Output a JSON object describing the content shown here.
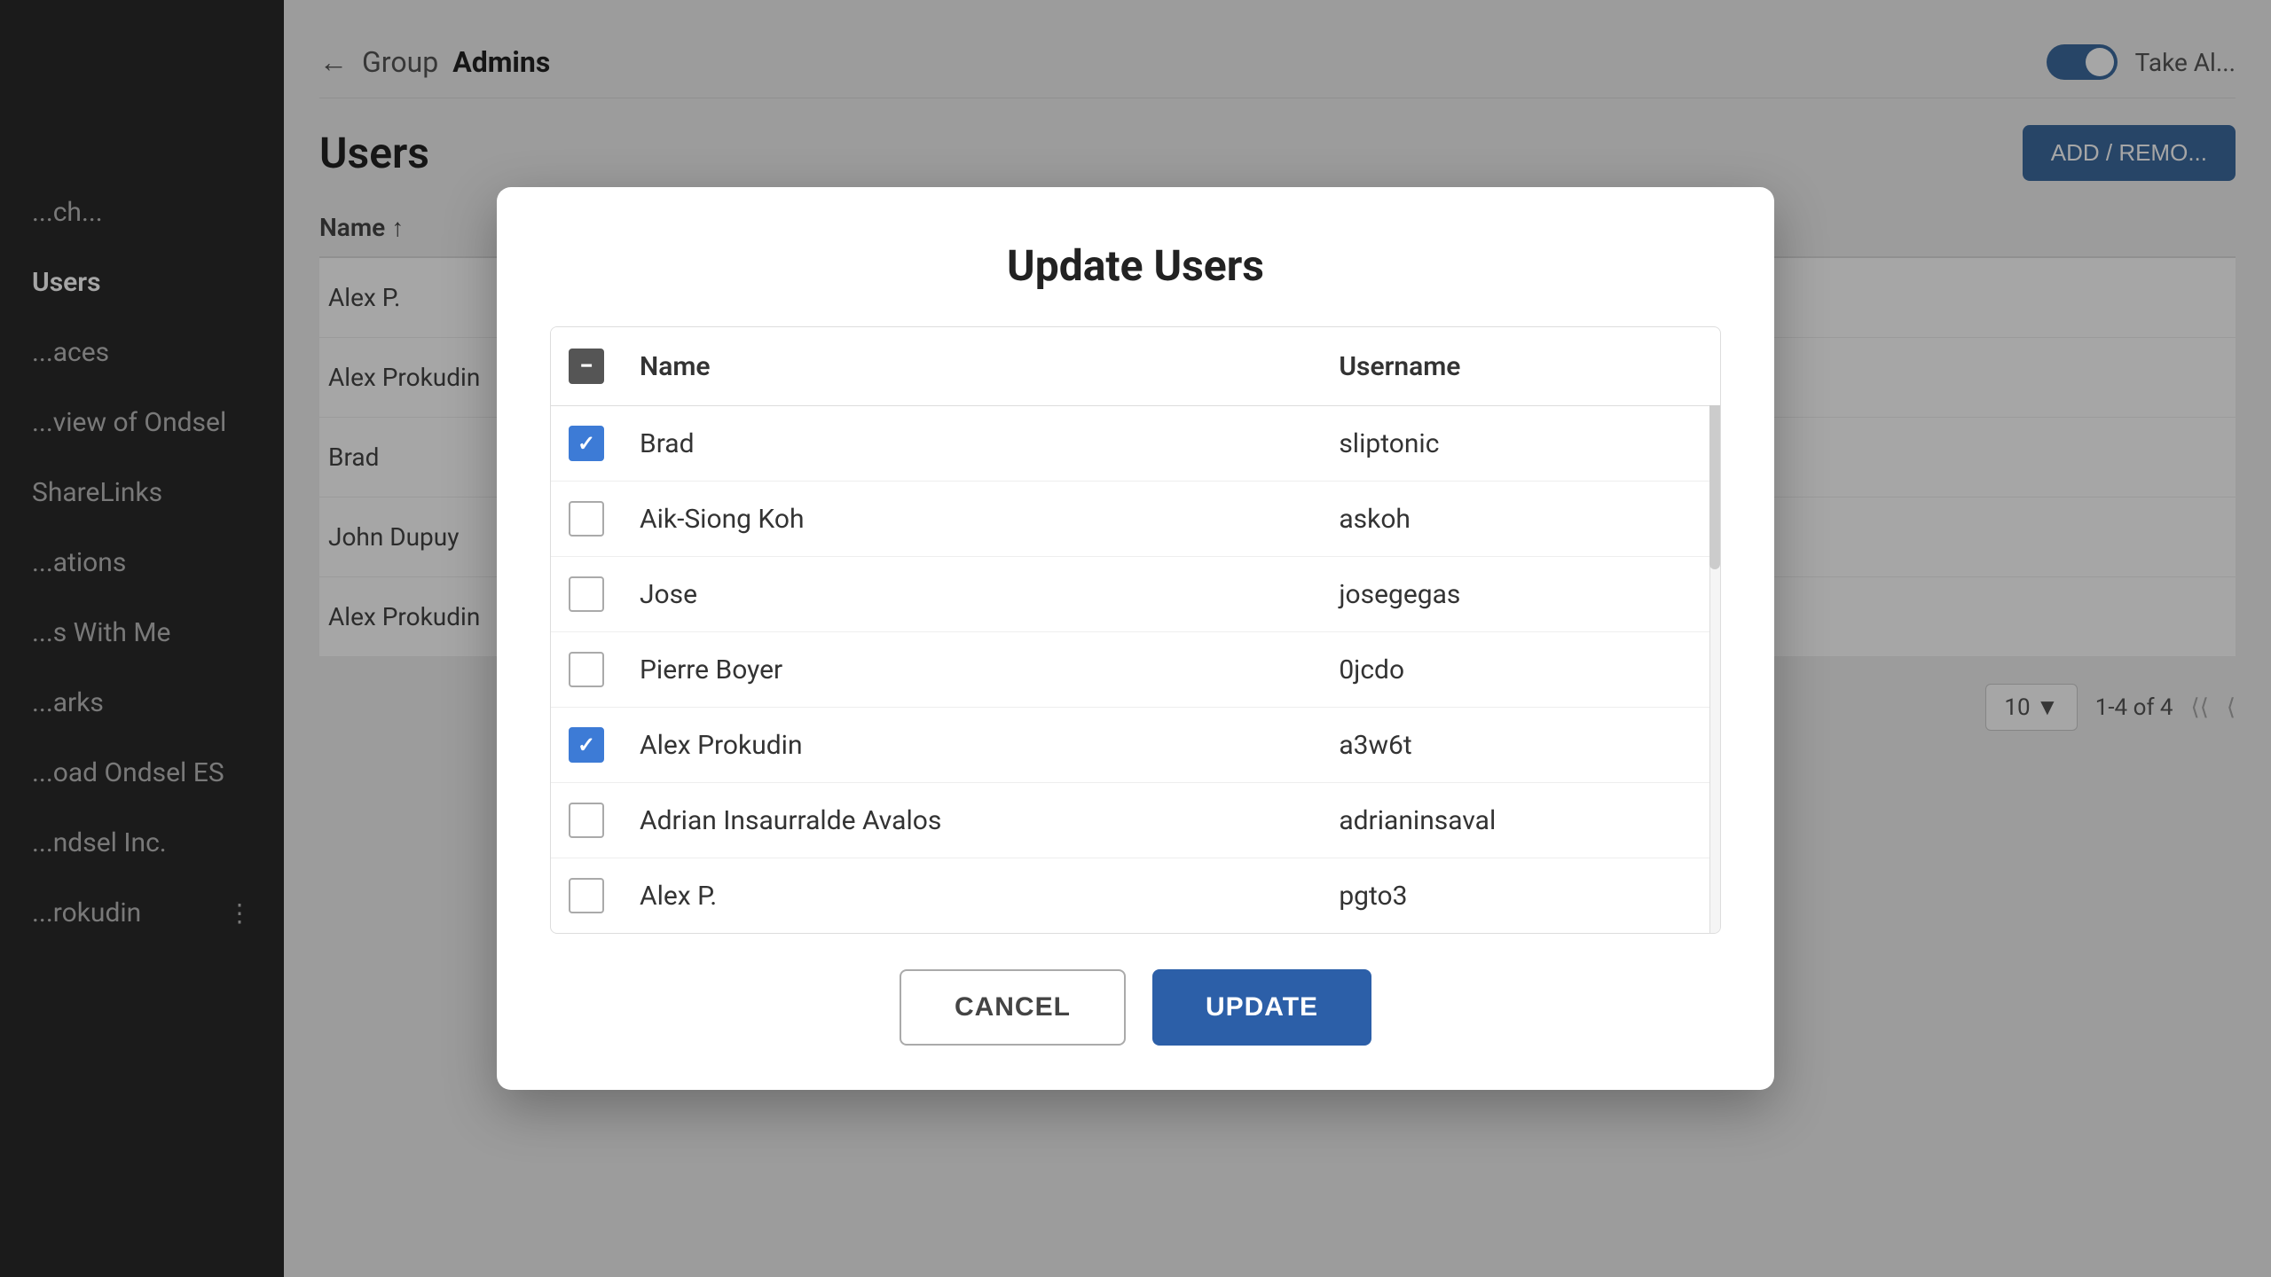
{
  "page": {
    "title": "Update Users"
  },
  "header": {
    "back_label": "←",
    "group_label": "Group",
    "group_name": "Admins",
    "toggle_label": "Take Al...",
    "add_remove_label": "ADD / REMO..."
  },
  "sidebar": {
    "items": [
      {
        "label": "...ch...",
        "active": false
      },
      {
        "label": "Users",
        "active": true
      },
      {
        "label": "...aces",
        "active": false
      },
      {
        "label": "...view of Ondsel",
        "active": false
      },
      {
        "label": "ShareLinks",
        "active": false
      },
      {
        "label": "...ations",
        "active": false
      },
      {
        "label": "...s With Me",
        "active": false
      },
      {
        "label": "...arks",
        "active": false
      },
      {
        "label": "...oad Ondsel ES",
        "active": false
      },
      {
        "label": "...ndsel Inc.",
        "active": false
      },
      {
        "label": "...rokudin",
        "active": false
      }
    ]
  },
  "background_users": [
    {
      "name": "Alex P."
    },
    {
      "name": "Alex Prokudin"
    },
    {
      "name": "Brad"
    },
    {
      "name": "John Dupuy"
    },
    {
      "name": "Alex Prokudin"
    }
  ],
  "modal": {
    "title": "Update Users",
    "columns": {
      "name": "Name",
      "username": "Username"
    },
    "users": [
      {
        "id": 1,
        "name": "Brad",
        "username": "sliptonic",
        "checked": true,
        "indeterminate": false
      },
      {
        "id": 2,
        "name": "Aik-Siong Koh",
        "username": "askoh",
        "checked": false,
        "indeterminate": false
      },
      {
        "id": 3,
        "name": "Jose",
        "username": "josegegas",
        "checked": false,
        "indeterminate": false
      },
      {
        "id": 4,
        "name": "Pierre Boyer",
        "username": "0jcdo",
        "checked": false,
        "indeterminate": false
      },
      {
        "id": 5,
        "name": "Alex Prokudin",
        "username": "a3w6t",
        "checked": true,
        "indeterminate": false
      },
      {
        "id": 6,
        "name": "Adrian Insaurralde Avalos",
        "username": "adrianinsaval",
        "checked": false,
        "indeterminate": false
      },
      {
        "id": 7,
        "name": "Alex P.",
        "username": "pgto3",
        "checked": false,
        "indeterminate": false
      }
    ],
    "header_checkbox": "indeterminate",
    "cancel_label": "CANCEL",
    "update_label": "UPDATE",
    "pagination": {
      "per_page": "10",
      "range": "1-4 of 4"
    }
  }
}
